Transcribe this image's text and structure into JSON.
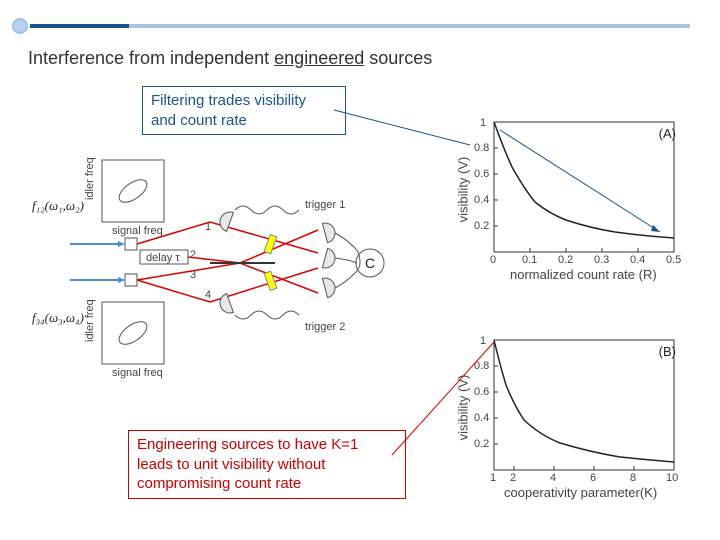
{
  "header": {
    "title_pre": "Interference from independent ",
    "title_underlined": "engineered",
    "title_post": " sources"
  },
  "callouts": {
    "blue": "Filtering trades visibility\nand count rate",
    "red": "Engineering sources to have K=1\nleads to unit visibility without\ncompromising count rate"
  },
  "schematic": {
    "f12": "f₁₂(ω₁,ω₂)",
    "f34": "f₃₄(ω₃,ω₄)",
    "idler": "idler freq",
    "signal": "signal freq",
    "delay": "delay τ",
    "trigger1": "trigger 1",
    "trigger2": "trigger 2",
    "c": "C",
    "n1": "1",
    "n2": "2",
    "n3": "3",
    "n4": "4"
  },
  "chart_data": [
    {
      "panel": "(A)",
      "type": "line",
      "title": "",
      "xlabel": "normalized count rate (R)",
      "ylabel": "visibility (V)",
      "xlim": [
        0,
        0.5
      ],
      "ylim": [
        0,
        1
      ],
      "xticks": [
        0,
        0.1,
        0.2,
        0.3,
        0.4,
        0.5
      ],
      "yticks": [
        0.2,
        0.4,
        0.6,
        0.8,
        1
      ],
      "series": [
        {
          "name": "curve",
          "x": [
            0.0,
            0.02,
            0.05,
            0.1,
            0.15,
            0.2,
            0.3,
            0.4,
            0.5
          ],
          "y": [
            1.0,
            0.85,
            0.67,
            0.5,
            0.41,
            0.35,
            0.28,
            0.23,
            0.2
          ]
        }
      ],
      "annotations": [
        {
          "type": "arrow",
          "from": [
            0.02,
            0.95
          ],
          "to": [
            0.45,
            0.22
          ],
          "color": "#1a5490"
        }
      ]
    },
    {
      "panel": "(B)",
      "type": "line",
      "title": "",
      "xlabel": "cooperativity parameter(K)",
      "ylabel": "visibility (V)",
      "xlim": [
        1,
        10
      ],
      "ylim": [
        0,
        1
      ],
      "xticks": [
        1,
        2,
        4,
        6,
        8,
        10
      ],
      "yticks": [
        0.2,
        0.4,
        0.6,
        0.8,
        1
      ],
      "series": [
        {
          "name": "curve",
          "x": [
            1,
            1.3,
            1.7,
            2,
            2.5,
            3,
            4,
            5,
            6,
            8,
            10
          ],
          "y": [
            1.0,
            0.82,
            0.65,
            0.55,
            0.44,
            0.37,
            0.29,
            0.24,
            0.21,
            0.17,
            0.15
          ]
        }
      ],
      "annotations": [
        {
          "type": "line",
          "from_external": true,
          "to": [
            1,
            1
          ],
          "color": "#d00"
        }
      ]
    }
  ]
}
